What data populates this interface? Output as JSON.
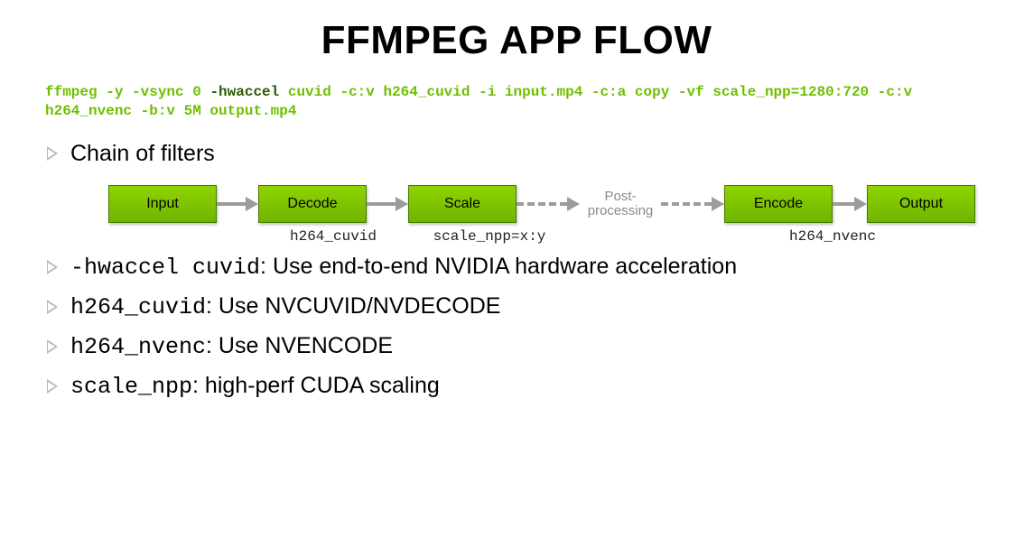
{
  "title": "FFMPEG APP FLOW",
  "command": {
    "seg_green1": "ffmpeg -y -vsync 0 ",
    "seg_dark1": "-hwaccel",
    "seg_green2": " cuvid -c:v h264_cuvid -i input.mp4 -c:a copy -vf scale_npp=1280:720 -c:v h264_nvenc -b:v 5M output.mp4"
  },
  "bullets": {
    "chain": "Chain of filters",
    "hwaccel_code": "-hwaccel cuvid",
    "hwaccel_desc": ": Use end-to-end NVIDIA hardware acceleration",
    "cuvid_code": "h264_cuvid",
    "cuvid_desc": ": Use NVCUVID/NVDECODE",
    "nvenc_code": "h264_nvenc",
    "nvenc_desc": ": Use NVENCODE",
    "scalenpp_code": "scale_npp",
    "scalenpp_desc": ": high-perf CUDA scaling"
  },
  "flow": {
    "input": "Input",
    "decode": "Decode",
    "scale": "Scale",
    "post1": "Post-",
    "post2": "processing",
    "encode": "Encode",
    "output": "Output"
  },
  "captions": {
    "decode": "h264_cuvid",
    "scale": "scale_npp=x:y",
    "encode": "h264_nvenc"
  }
}
